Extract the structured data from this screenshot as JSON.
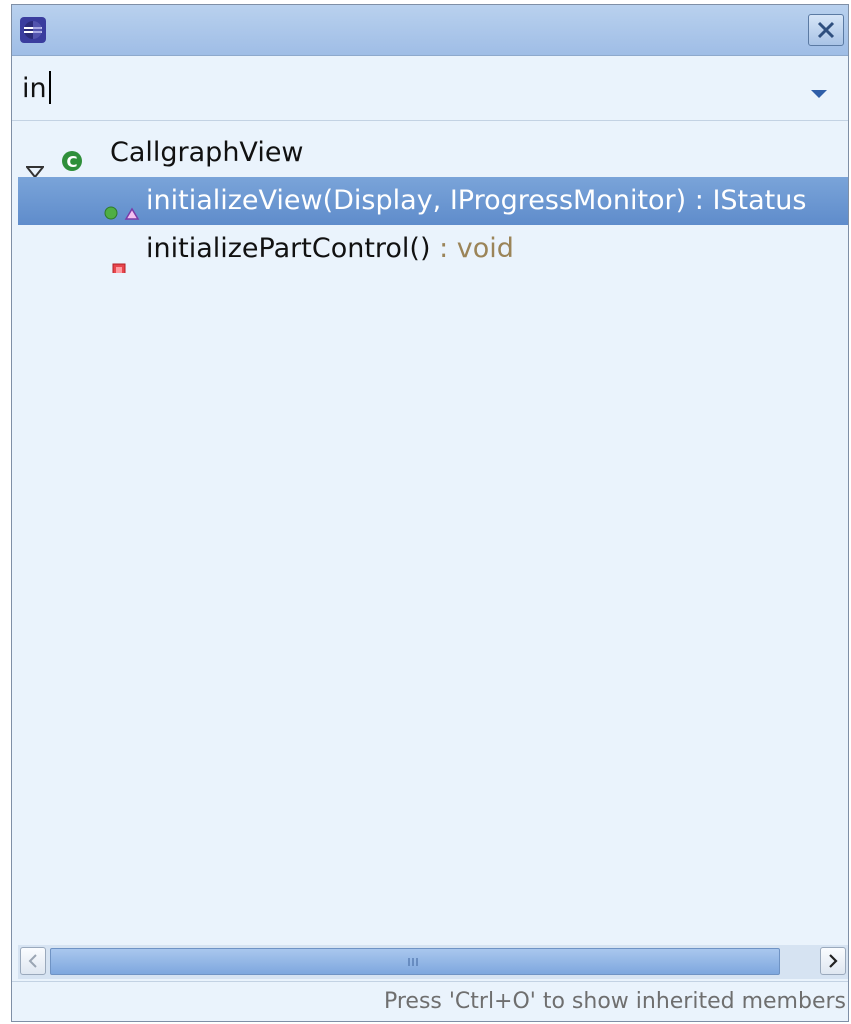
{
  "filter": {
    "value": "in"
  },
  "tree": {
    "root": {
      "label": "CallgraphView"
    },
    "items": [
      {
        "name": "initializeView(Display, IProgressMonitor)",
        "ret": " : IStatus",
        "selected": true
      },
      {
        "name": "initializePartControl()",
        "ret": " : void",
        "selected": false
      }
    ]
  },
  "status": {
    "text": "Press 'Ctrl+O' to show inherited members"
  },
  "colors": {
    "selection": "#6f98d2",
    "background": "#eaf3fc",
    "title": "#a9c4e9",
    "return_type": "#9b8458"
  },
  "icons": {
    "app": "eclipse-icon",
    "close": "close-icon",
    "class": "class-icon",
    "public_method": "public-method-icon",
    "private_method": "private-method-icon",
    "dropdown": "dropdown-triangle-icon"
  }
}
